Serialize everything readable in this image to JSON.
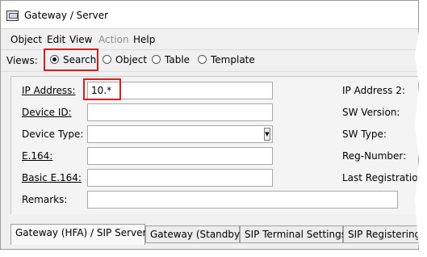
{
  "window": {
    "title": "Gateway / Server"
  },
  "menu": [
    "Object",
    "Edit",
    "View",
    "Action",
    "Help"
  ],
  "views": {
    "label": "Views:",
    "options": [
      "Search",
      "Object",
      "Table",
      "Template"
    ],
    "selected": "Search"
  },
  "form": {
    "ip_address": {
      "label": "IP Address:",
      "value": "10.*"
    },
    "device_id": {
      "label": "Device ID:",
      "value": ""
    },
    "device_type": {
      "label": "Device Type:",
      "value": ""
    },
    "e164": {
      "label": "E.164:",
      "value": ""
    },
    "basic_e164": {
      "label": "Basic E.164:",
      "value": ""
    },
    "remarks": {
      "label": "Remarks:",
      "value": ""
    },
    "right_labels": [
      "IP Address 2:",
      "SW Version:",
      "SW Type:",
      "Reg-Number:",
      "Last Registration"
    ]
  },
  "tabs": [
    "Gateway (HFA) / SIP Server",
    "Gateway (Standby)",
    "SIP Terminal Settings",
    "SIP Registering"
  ],
  "colors": {
    "highlight": "#d42020"
  }
}
